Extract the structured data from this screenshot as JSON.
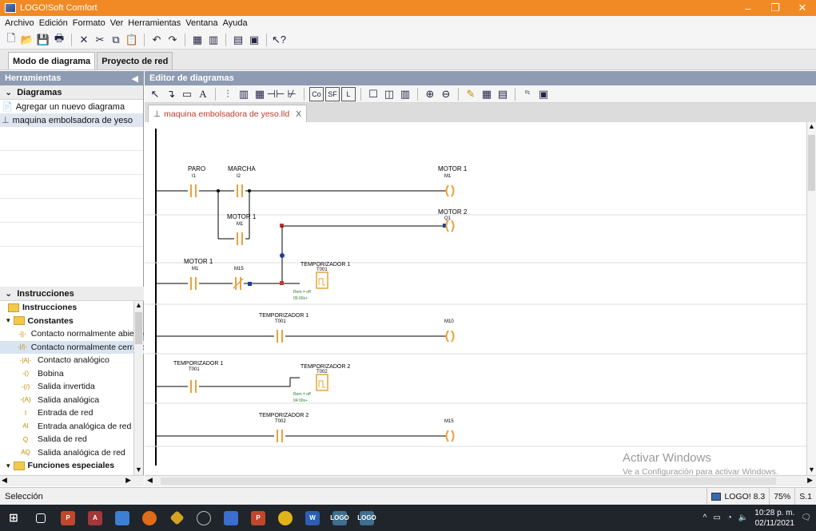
{
  "window": {
    "title": "LOGO!Soft Comfort"
  },
  "menu": [
    "Archivo",
    "Edición",
    "Formato",
    "Ver",
    "Herramientas",
    "Ventana",
    "Ayuda"
  ],
  "mode_tabs": [
    "Modo de diagrama",
    "Proyecto de red"
  ],
  "left_pane": {
    "header": "Herramientas",
    "diagrams_section": "Diagramas",
    "diagram_items": [
      "Agregar un nuevo diagrama",
      "maquina embolsadora  de yeso"
    ],
    "instructions_section": "Instrucciones",
    "tree": [
      {
        "label": "Instrucciones",
        "level": 0,
        "type": "folder",
        "bold": true
      },
      {
        "label": "Constantes",
        "level": 1,
        "type": "folder",
        "bold": true
      },
      {
        "label": "Contacto normalmente abierto",
        "level": 2,
        "type": "leaf",
        "icon": "-||-"
      },
      {
        "label": "Contacto normalmente cerrado",
        "level": 2,
        "type": "leaf",
        "icon": "-|/|-",
        "selected": true
      },
      {
        "label": "Contacto analógico",
        "level": 2,
        "type": "leaf",
        "icon": "-|A|-"
      },
      {
        "label": "Bobina",
        "level": 2,
        "type": "leaf",
        "icon": "-()"
      },
      {
        "label": "Salida invertida",
        "level": 2,
        "type": "leaf",
        "icon": "-(/)"
      },
      {
        "label": "Salida analógica",
        "level": 2,
        "type": "leaf",
        "icon": "-(A)"
      },
      {
        "label": "Entrada de red",
        "level": 2,
        "type": "leaf",
        "icon": "I"
      },
      {
        "label": "Entrada analógica de red",
        "level": 2,
        "type": "leaf",
        "icon": "AI"
      },
      {
        "label": "Salida de red",
        "level": 2,
        "type": "leaf",
        "icon": "Q"
      },
      {
        "label": "Salida analógica de red",
        "level": 2,
        "type": "leaf",
        "icon": "AQ"
      },
      {
        "label": "Funciones especiales",
        "level": 1,
        "type": "folder",
        "bold": true
      }
    ]
  },
  "editor": {
    "header": "Editor de diagramas",
    "file_tab": "maquina embolsadora  de yeso.lld",
    "tab_close": "X"
  },
  "ladder": {
    "rung1": {
      "c1_name": "PARO",
      "c1_addr": "I1",
      "c2_name": "MARCHA",
      "c2_addr": "I2",
      "coil_name": "MOTOR 1",
      "coil_addr": "M1"
    },
    "rung2": {
      "c1_name": "MOTOR 1",
      "c1_addr": "M1",
      "coil_name": "MOTOR 2",
      "coil_addr": "Q1"
    },
    "rung3": {
      "c1_name": "MOTOR 1",
      "c1_addr": "M1",
      "c2_addr": "M15",
      "timer_name": "TEMPORIZADOR 1",
      "timer_addr": "T001",
      "param1": "Rem = off",
      "param2": "05:00s+"
    },
    "rung4": {
      "c1_name": "TEMPORIZADOR 1",
      "c1_addr": "T001",
      "coil_addr": "M10"
    },
    "rung5": {
      "c1_name": "TEMPORIZADOR 1",
      "c1_addr": "T001",
      "timer_name": "TEMPORIZADOR 2",
      "timer_addr": "T002",
      "param1": "Rem = off",
      "param2": "04:00s+"
    },
    "rung6": {
      "c1_name": "TEMPORIZADOR 2",
      "c1_addr": "T002",
      "coil_addr": "M15"
    }
  },
  "watermark": {
    "line1": "Activar Windows",
    "line2": "Ve a Configuración para activar Windows."
  },
  "status": {
    "left": "Selección",
    "device": "LOGO! 8.3",
    "zoom": "75%",
    "page": "S.1"
  },
  "taskbar": {
    "time": "10:28 p. m.",
    "date": "02/11/2021"
  },
  "colors": {
    "title_bar": "#f18a24",
    "pane_header": "#8e9bb3",
    "element": "#e8a33a",
    "wire": "#000000",
    "taskbar": "#20242b"
  }
}
